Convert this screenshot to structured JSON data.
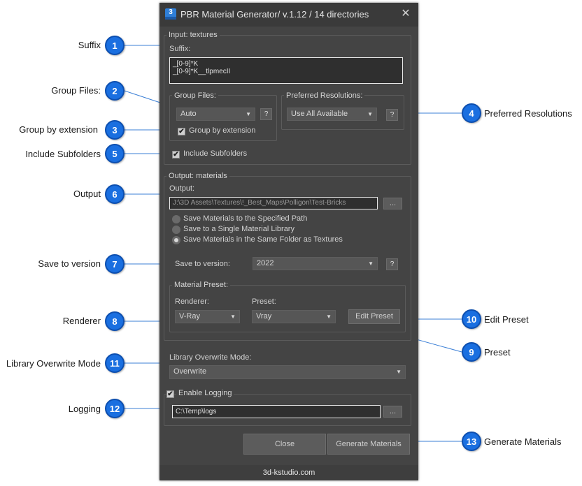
{
  "dialog": {
    "title": "PBR Material Generator/ v.1.12 / 14 directories",
    "footer": "3d-kstudio.com"
  },
  "input": {
    "group_label": "Input: textures",
    "suffix_label": "Suffix:",
    "suffix_line1": "_[0-9]*K",
    "suffix_line2": "_[0-9]*K__tlpmecII",
    "group_files_label": "Group Files:",
    "group_files_value": "Auto",
    "group_by_ext_label": "Group by extension",
    "pref_res_label": "Preferred Resolutions:",
    "pref_res_value": "Use All Available",
    "include_subfolders_label": "Include Subfolders",
    "help": "?"
  },
  "output": {
    "group_label": "Output: materials",
    "output_label": "Output:",
    "output_path": "J:\\3D Assets\\Textures\\!_Best_Maps\\Polligon\\Test-Bricks",
    "browse": "...",
    "radio1": "Save Materials to the Specified Path",
    "radio2": "Save to a Single Material Library",
    "radio3": "Save Materials in the Same Folder as Textures",
    "save_version_label": "Save to version:",
    "save_version_value": "2022",
    "material_preset_label": "Material Preset:",
    "renderer_label": "Renderer:",
    "renderer_value": "V-Ray",
    "preset_label": "Preset:",
    "preset_value": "Vray",
    "edit_preset": "Edit Preset"
  },
  "library": {
    "label": "Library Overwrite Mode:",
    "value": "Overwrite"
  },
  "logging": {
    "enable_label": "Enable Logging",
    "path": "C:\\Temp\\logs",
    "browse": "..."
  },
  "actions": {
    "close": "Close",
    "generate": "Generate Materials"
  },
  "callouts": [
    {
      "num": "1",
      "label": "Suffix"
    },
    {
      "num": "2",
      "label": "Group Files:"
    },
    {
      "num": "3",
      "label": "Group by extension"
    },
    {
      "num": "4",
      "label": "Preferred Resolutions"
    },
    {
      "num": "5",
      "label": "Include Subfolders"
    },
    {
      "num": "6",
      "label": "Output"
    },
    {
      "num": "7",
      "label": "Save to version"
    },
    {
      "num": "8",
      "label": "Renderer"
    },
    {
      "num": "9",
      "label": "Preset"
    },
    {
      "num": "10",
      "label": "Edit Preset"
    },
    {
      "num": "11",
      "label": "Library Overwrite Mode"
    },
    {
      "num": "12",
      "label": "Logging"
    },
    {
      "num": "13",
      "label": "Generate Materials"
    }
  ],
  "colors": {
    "badge": "#1a6fe0",
    "dialog_bg": "#444444",
    "leader": "#3b7fd6"
  }
}
